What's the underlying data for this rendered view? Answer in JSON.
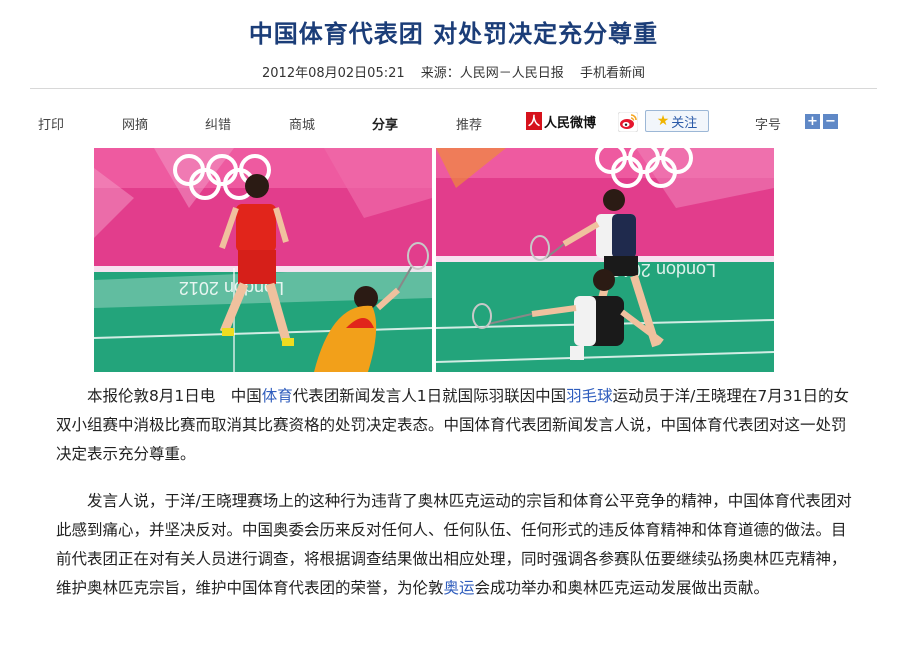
{
  "article": {
    "title": "中国体育代表团  对处罚决定充分尊重",
    "datetime": "2012年08月02日05:21",
    "source": "来源：人民网－人民日报",
    "mobile_link": "手机看新闻"
  },
  "toolbar": {
    "print": "打印",
    "wangzhai": "网摘",
    "jiucuo": "纠错",
    "shangcheng": "商城",
    "share": "分享",
    "recommend": "推荐",
    "weibo_badge": "人",
    "weibo_label": "人民微博",
    "follow": "关注",
    "font_size": "字号",
    "plus": "+",
    "minus": "−"
  },
  "icons": {
    "weibo": "people-weibo-icon",
    "sina": "sina-weibo-icon",
    "follow": "star-icon"
  },
  "colors": {
    "title": "#1b3d78",
    "link": "#2f5dbd",
    "weibo_red": "#d6121c",
    "font_button": "#5f88c6"
  },
  "photos": [
    {
      "banner_text": "London 2012",
      "scene": "China doubles players, red uniforms"
    },
    {
      "banner_text": "London 2012",
      "scene": "Korea doubles players, white and black uniforms"
    }
  ],
  "body": {
    "p1_pre": "本报伦敦8月1日电　中国",
    "p1_link1": "体育",
    "p1_mid": "代表团新闻发言人1日就国际羽联因中国",
    "p1_link2": "羽毛球",
    "p1_post": "运动员于洋/王晓理在7月31日的女双小组赛中消极比赛而取消其比赛资格的处罚决定表态。中国体育代表团新闻发言人说，中国体育代表团对这一处罚决定表示充分尊重。",
    "p2_pre": "发言人说，于洋/王晓理赛场上的这种行为违背了奥林匹克运动的宗旨和体育公平竞争的精神，中国体育代表团对此感到痛心，并坚决反对。中国奥委会历来反对任何人、任何队伍、任何形式的违反体育精神和体育道德的做法。目前代表团正在对有关人员进行调查，将根据调查结果做出相应处理，同时强调各参赛队伍要继续弘扬奥林匹克精神，维护奥林匹克宗旨，维护中国体育代表团的荣誉，为伦敦",
    "p2_link": "奥运",
    "p2_post": "会成功举办和奥林匹克运动发展做出贡献。"
  }
}
